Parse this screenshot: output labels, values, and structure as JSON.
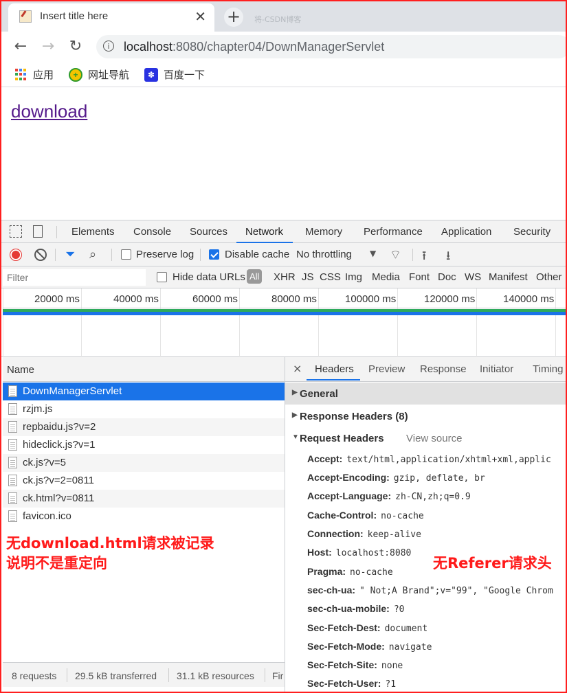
{
  "browser": {
    "tab_title": "Insert title here",
    "ghost_tab_text": "将-CSDN博客",
    "url_host": "localhost",
    "url_rest": ":8080/chapter04/DownManagerServlet",
    "bookmarks": [
      {
        "label": "应用",
        "icon": "apps-icon"
      },
      {
        "label": "网址导航",
        "icon": "nav-icon"
      },
      {
        "label": "百度一下",
        "icon": "baidu-paw-icon"
      }
    ]
  },
  "page": {
    "link_text": "download"
  },
  "devtools": {
    "tabs": [
      "Elements",
      "Console",
      "Sources",
      "Network",
      "Memory",
      "Performance",
      "Application",
      "Security"
    ],
    "active_tab": "Network",
    "toolbar": {
      "preserve_log": "Preserve log",
      "disable_cache": "Disable cache",
      "throttling": "No throttling"
    },
    "filter": {
      "placeholder": "Filter",
      "hide_data_urls": "Hide data URLs",
      "types": [
        "All",
        "XHR",
        "JS",
        "CSS",
        "Img",
        "Media",
        "Font",
        "Doc",
        "WS",
        "Manifest",
        "Other"
      ]
    },
    "timeline_ticks": [
      "20000 ms",
      "40000 ms",
      "60000 ms",
      "80000 ms",
      "100000 ms",
      "120000 ms",
      "140000 ms"
    ],
    "requests": {
      "header": "Name",
      "items": [
        "DownManagerServlet",
        "rzjm.js",
        "repbaidu.js?v=2",
        "hideclick.js?v=1",
        "ck.js?v=5",
        "ck.js?v=2=0811",
        "ck.html?v=0811",
        "favicon.ico"
      ],
      "selected_index": 0,
      "status": [
        "8 requests",
        "29.5 kB transferred",
        "31.1 kB resources",
        "Fir"
      ]
    },
    "headers_panel": {
      "close": "×",
      "tabs": [
        "Headers",
        "Preview",
        "Response",
        "Initiator",
        "Timing"
      ],
      "general": "General",
      "response_headers": "Response Headers (8)",
      "request_headers": "Request Headers",
      "view_source": "View source",
      "rows": [
        {
          "k": "Accept:",
          "v": "text/html,application/xhtml+xml,applic"
        },
        {
          "k": "Accept-Encoding:",
          "v": "gzip, deflate, br"
        },
        {
          "k": "Accept-Language:",
          "v": "zh-CN,zh;q=0.9"
        },
        {
          "k": "Cache-Control:",
          "v": "no-cache"
        },
        {
          "k": "Connection:",
          "v": "keep-alive"
        },
        {
          "k": "Host:",
          "v": "localhost:8080"
        },
        {
          "k": "Pragma:",
          "v": "no-cache"
        },
        {
          "k": "sec-ch-ua:",
          "v": "\" Not;A Brand\";v=\"99\", \"Google Chrom"
        },
        {
          "k": "sec-ch-ua-mobile:",
          "v": "?0"
        },
        {
          "k": "Sec-Fetch-Dest:",
          "v": "document"
        },
        {
          "k": "Sec-Fetch-Mode:",
          "v": "navigate"
        },
        {
          "k": "Sec-Fetch-Site:",
          "v": "none"
        },
        {
          "k": "Sec-Fetch-User:",
          "v": "?1"
        }
      ]
    }
  },
  "annotations": {
    "left_line1": "无download.html请求被记录",
    "left_line2": "说明不是重定向",
    "right": "无Referer请求头"
  },
  "colors": {
    "accent": "#1a73e8",
    "record": "#e53935",
    "annotation": "#ff1a1a",
    "frame": "#ff1f1f",
    "visited_link": "#551a8b"
  }
}
